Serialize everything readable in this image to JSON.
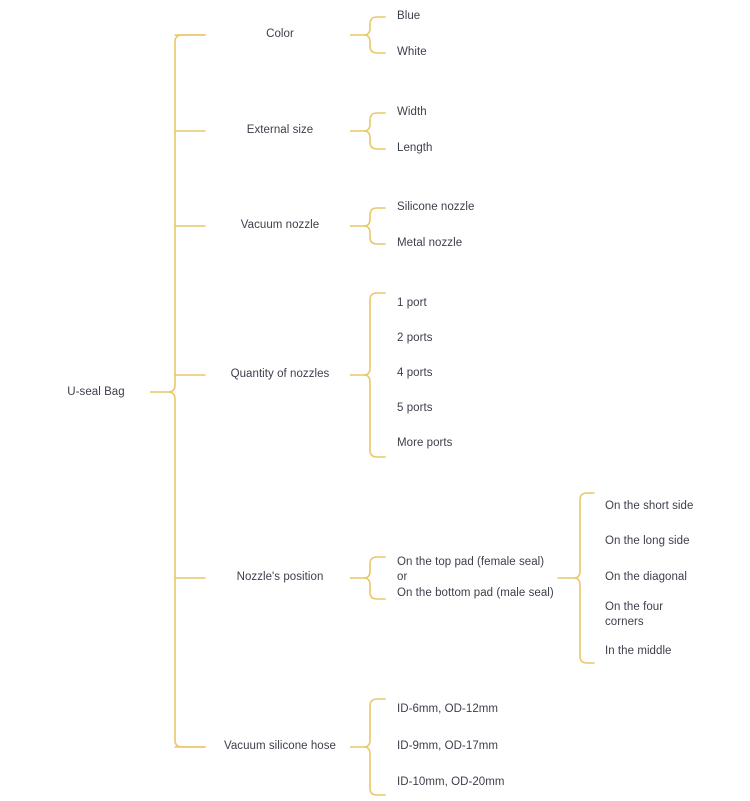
{
  "diagram": {
    "type": "mind-map-bracket",
    "title": "U-seal Bag product option tree",
    "accent_color": "#e9c76a",
    "text_color": "#3c3f4c",
    "background_color": "#ffffff",
    "root": {
      "label": "U-seal Bag"
    },
    "branches": [
      {
        "label": "Color",
        "children": [
          {
            "label": "Blue"
          },
          {
            "label": "White"
          }
        ]
      },
      {
        "label": "External size",
        "children": [
          {
            "label": "Width"
          },
          {
            "label": "Length"
          }
        ]
      },
      {
        "label": "Vacuum nozzle",
        "children": [
          {
            "label": "Silicone nozzle"
          },
          {
            "label": "Metal nozzle"
          }
        ]
      },
      {
        "label": "Quantity of nozzles",
        "children": [
          {
            "label": "1 port"
          },
          {
            "label": "2 ports"
          },
          {
            "label": "4 ports"
          },
          {
            "label": "5 ports"
          },
          {
            "label": "More ports"
          }
        ]
      },
      {
        "label": "Nozzle's position",
        "children": [
          {
            "label": "On the top pad (female seal) or\nOn the bottom pad (male seal)",
            "children": [
              {
                "label": "On the short side"
              },
              {
                "label": "On the long side"
              },
              {
                "label": "On the diagonal"
              },
              {
                "label": "On the four corners"
              },
              {
                "label": "In the middle"
              }
            ]
          }
        ]
      },
      {
        "label": "Vacuum silicone hose",
        "children": [
          {
            "label": "ID-6mm, OD-12mm"
          },
          {
            "label": "ID-9mm, OD-17mm"
          },
          {
            "label": "ID-10mm, OD-20mm"
          }
        ]
      }
    ]
  },
  "nodes": {
    "root": "U-seal Bag",
    "b0": "Color",
    "b0c0": "Blue",
    "b0c1": "White",
    "b1": "External size",
    "b1c0": "Width",
    "b1c1": "Length",
    "b2": "Vacuum nozzle",
    "b2c0": "Silicone nozzle",
    "b2c1": "Metal nozzle",
    "b3": "Quantity of nozzles",
    "b3c0": "1 port",
    "b3c1": "2 ports",
    "b3c2": "4 ports",
    "b3c3": "5 ports",
    "b3c4": "More ports",
    "b4": "Nozzle's position",
    "b4c0": "On the top pad (female seal) or\nOn the bottom pad (male seal)",
    "b4c0g0": "On the short side",
    "b4c0g1": "On the long side",
    "b4c0g2": "On the diagonal",
    "b4c0g3": "On the four corners",
    "b4c0g4": "In the middle",
    "b5": "Vacuum silicone hose",
    "b5c0": "ID-6mm, OD-12mm",
    "b5c1": "ID-9mm, OD-17mm",
    "b5c2": "ID-10mm, OD-20mm"
  }
}
